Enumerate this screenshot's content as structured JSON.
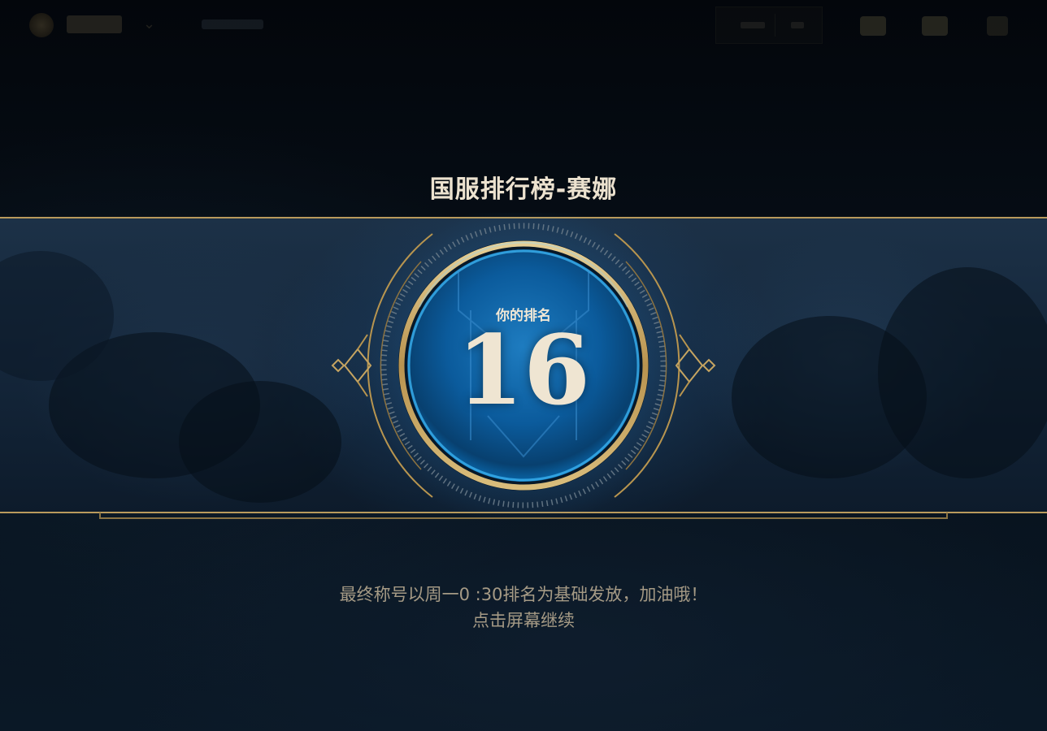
{
  "leaderboard": {
    "title": "国服排行榜-赛娜",
    "rank_label": "你的排名",
    "rank_value": "16"
  },
  "footer": {
    "notice": "最终称号以周一0 :30排名为基础发放，加油哦！",
    "continue_hint": "点击屏幕继续"
  },
  "overlay": {
    "side_id": "44559706"
  },
  "colors": {
    "gold": "#c8aa6e",
    "text_light": "#ece2cf",
    "text_muted": "#a59a85",
    "orb_blue": "#0a5fa3"
  }
}
